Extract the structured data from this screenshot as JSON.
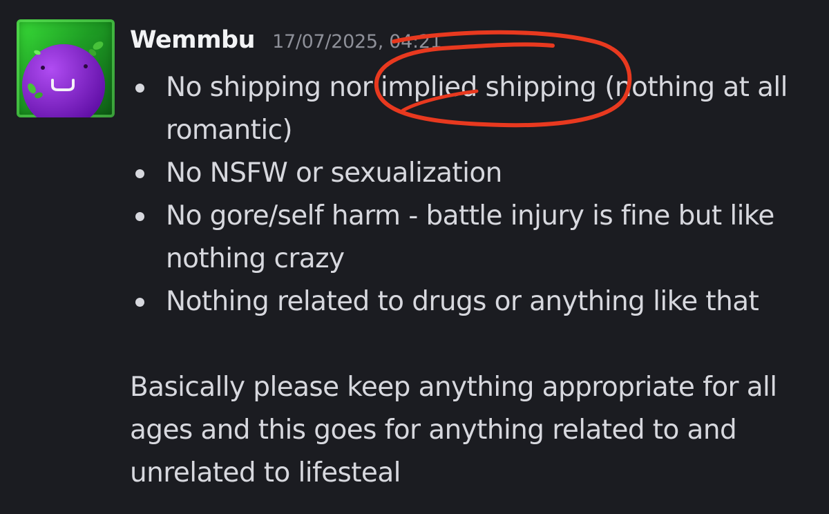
{
  "message": {
    "author": "Wemmbu",
    "timestamp": "17/07/2025, 04:21",
    "rules": [
      "No shipping nor implied shipping (nothing at all romantic)",
      "No NSFW or sexualization",
      "No gore/self harm - battle injury is fine but like nothing crazy",
      "Nothing related to drugs or anything like that"
    ],
    "closing": "Basically please keep anything appropriate for all ages and this goes for anything related to and unrelated to lifesteal"
  },
  "colors": {
    "background": "#1b1c21",
    "text": "#d7d8de",
    "username": "#f2f3f5",
    "timestamp": "#8e9099",
    "annotation": "#e8391f",
    "avatar_green": "#2fce2f",
    "avatar_purple": "#8b18d9"
  },
  "icons": {
    "avatar": "green-slime-cube-with-purple-ball-avatar",
    "annotation": "red-hand-drawn-circle"
  }
}
